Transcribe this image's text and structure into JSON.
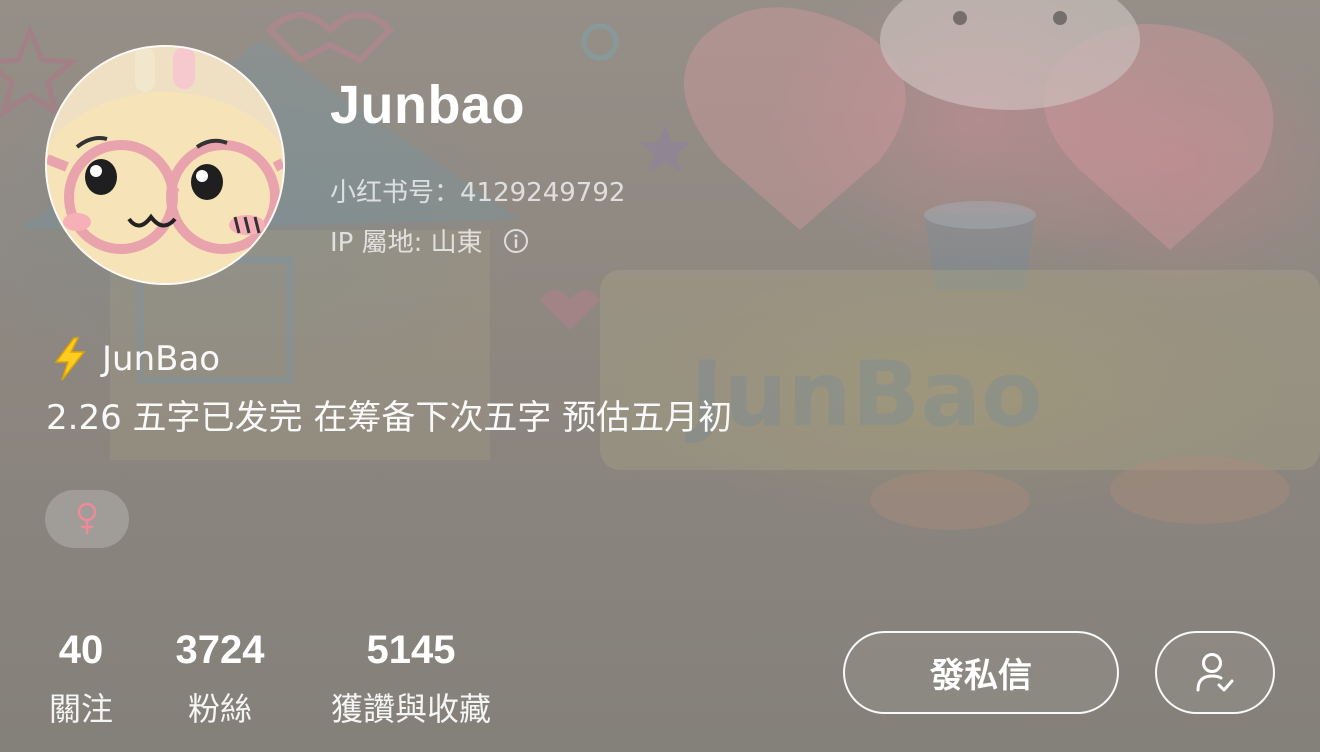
{
  "profile": {
    "username": "Junbao",
    "id_text": "小红书号：4129249792",
    "ip_text": "IP 屬地: 山東",
    "bio_title": "JunBao",
    "bio_text": "2.26 五字已发完 在筹备下次五字 预估五月初",
    "gender_symbol": "♀",
    "gender_color": "#f08a9a",
    "bio_icon": "lightning-bolt-icon",
    "info_icon": "info-circle-icon"
  },
  "stats": [
    {
      "value": "40",
      "label": "關注"
    },
    {
      "value": "3724",
      "label": "粉絲"
    },
    {
      "value": "5145",
      "label": "獲讚與收藏"
    }
  ],
  "actions": {
    "message_label": "發私信",
    "followed_icon": "user-check-icon"
  }
}
